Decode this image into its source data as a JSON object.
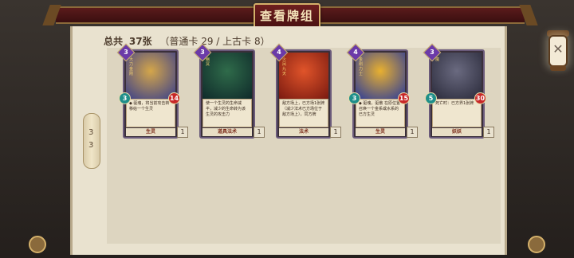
{
  "header": {
    "title": "查看牌组"
  },
  "summary": {
    "total_label": "总共",
    "total": "37张",
    "detail": "（普通卡 29 / 上古卡 8）"
  },
  "side_scroll": {
    "top": "3",
    "bottom": "3"
  },
  "colors": {
    "frame_red": "#5a1b1b",
    "parchment": "#e9e2cf",
    "cost_purple": "#6b3aa8",
    "attack_teal": "#1f8f8a",
    "health_red": "#c82828"
  },
  "cards": [
    {
      "cost": "3",
      "attack": "3",
      "health": "14",
      "name": "大力金刚",
      "desc": "◆ 驱魂，将当前攻击转移给一个生灵",
      "type": "生灵",
      "count": "1",
      "art": [
        "#d4a64a",
        "#3a3f8a"
      ]
    },
    {
      "cost": "3",
      "attack": "",
      "health": "",
      "name": "幽冥",
      "desc": "使一个生灵的生命减半，减少的生命转为该生灵的攻击力",
      "type": "道具法术",
      "count": "1",
      "art": [
        "#2f6b4a",
        "#0f2a2a"
      ]
    },
    {
      "cost": "4",
      "attack": "",
      "health": "",
      "name": "火凤九天",
      "desc": "敌方场上，已方场1张牌（减少法术已方场位于敌方场上），同方牌",
      "type": "法术",
      "count": "1",
      "art": [
        "#e0542a",
        "#7a1a10"
      ]
    },
    {
      "cost": "4",
      "attack": "3",
      "health": "15",
      "name": "金刚力士",
      "desc": "◆ 驱魂，驱散 在原位置召唤一个金系或水系的已方生灵",
      "type": "生灵",
      "count": "1",
      "art": [
        "#e8b030",
        "#2a3a9a"
      ]
    },
    {
      "cost": "3",
      "attack": "5",
      "health": "30",
      "name": "魔",
      "desc": "死亡时：已方界1张牌",
      "type": "妖妖",
      "count": "1",
      "art": [
        "#6a6a80",
        "#2a2a3a"
      ]
    }
  ]
}
